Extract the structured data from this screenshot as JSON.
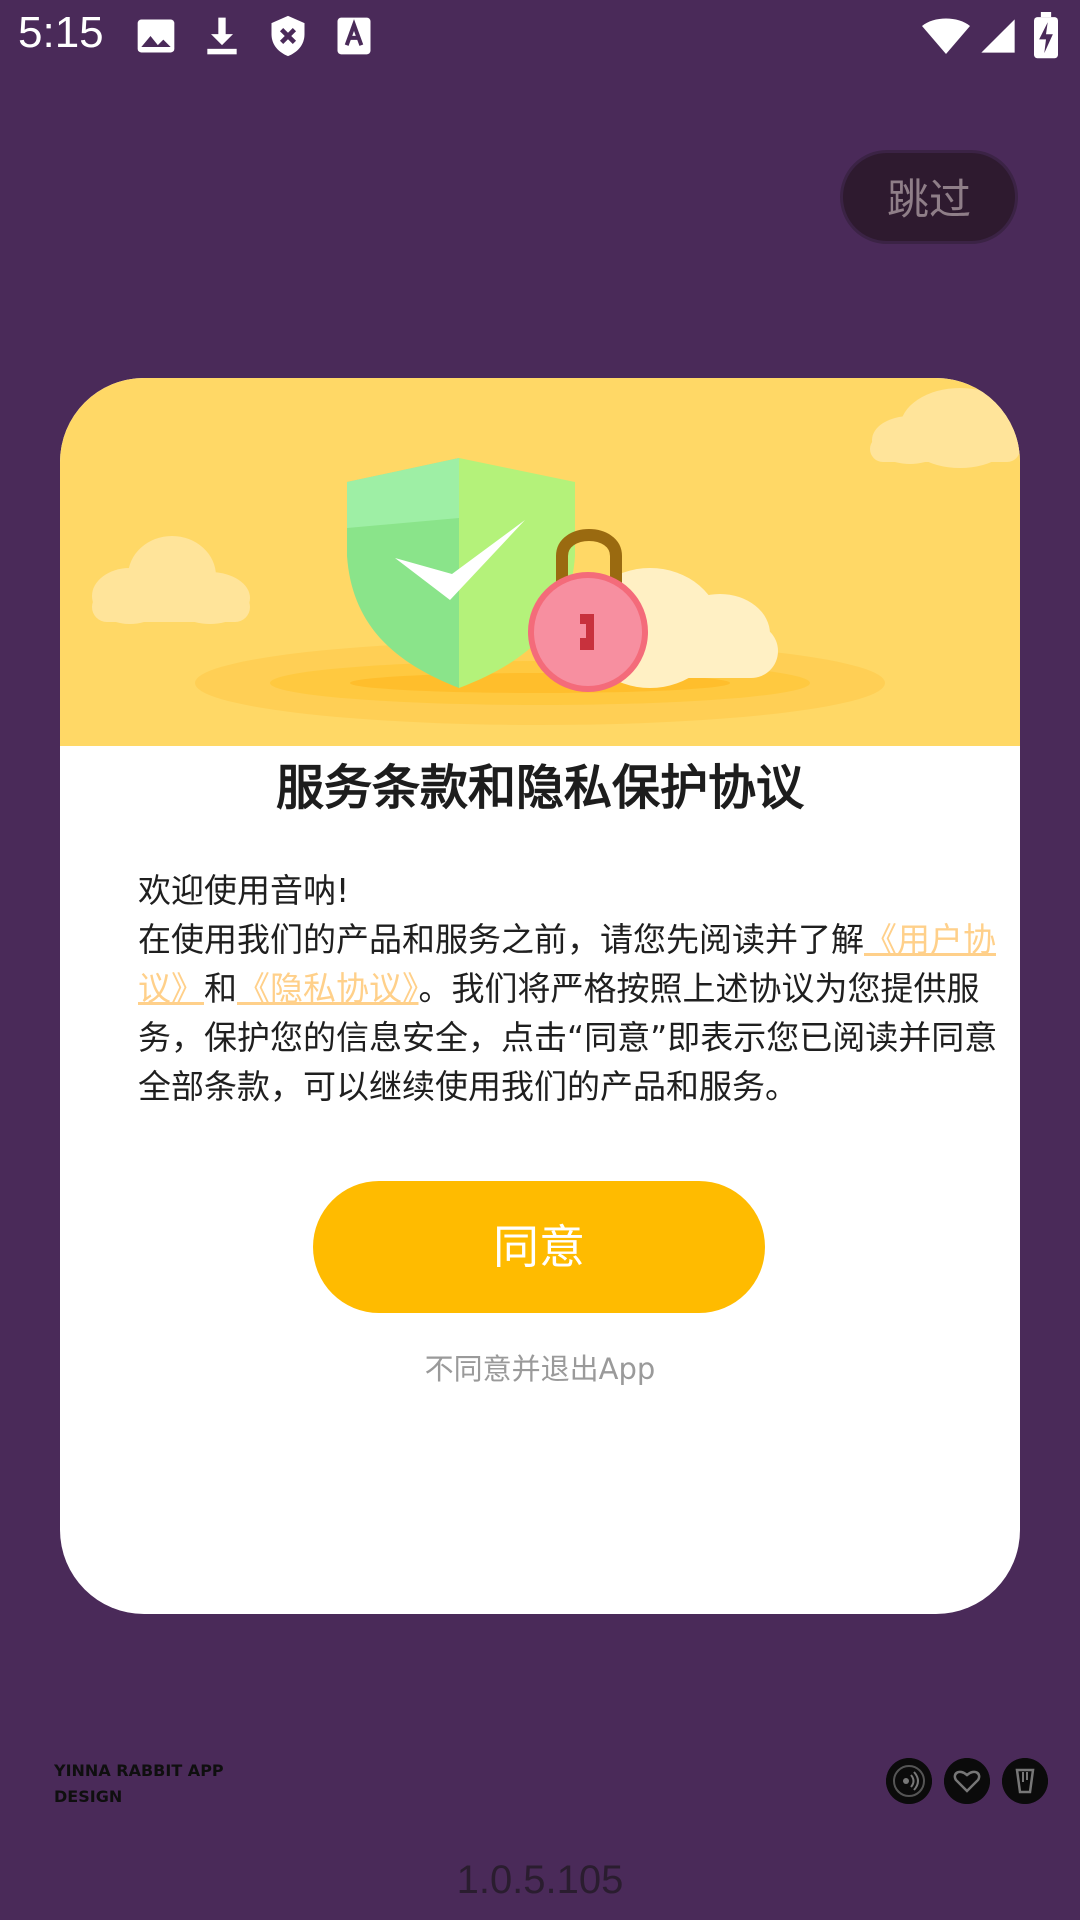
{
  "status_bar": {
    "time": "5:15",
    "left_icons": [
      "image-icon",
      "download-icon",
      "shield-x-icon",
      "keyboard-a-icon"
    ],
    "right_icons": [
      "wifi-icon",
      "signal-icon",
      "battery-charging-icon"
    ]
  },
  "skip_label": "跳过",
  "dialog": {
    "title": "服务条款和隐私保护协议",
    "welcome": "欢迎使用音呐!",
    "text_before": "在使用我们的产品和服务之前，请您先阅读并了解",
    "user_agreement_link": "《用户协议》",
    "and": "和",
    "privacy_link": "《隐私协议》",
    "text_after": "。我们将严格按照上述协议为您提供服务，保护您的信息安全，点击“同意”即表示您已阅读并同意全部条款，可以继续使用我们的产品和服务。",
    "agree_label": "同意",
    "decline_label": "不同意并退出App"
  },
  "branding": {
    "line1": "YINNA  RABBIT APP",
    "line2": "DESIGN"
  },
  "bottom_icons": [
    "sound-icon",
    "heart-icon",
    "glass-icon"
  ],
  "version": "1.0.5.105",
  "colors": {
    "background": "#4a2a59",
    "banner": "#ffd866",
    "accent": "#ffbb00",
    "link": "#ffd08a"
  }
}
